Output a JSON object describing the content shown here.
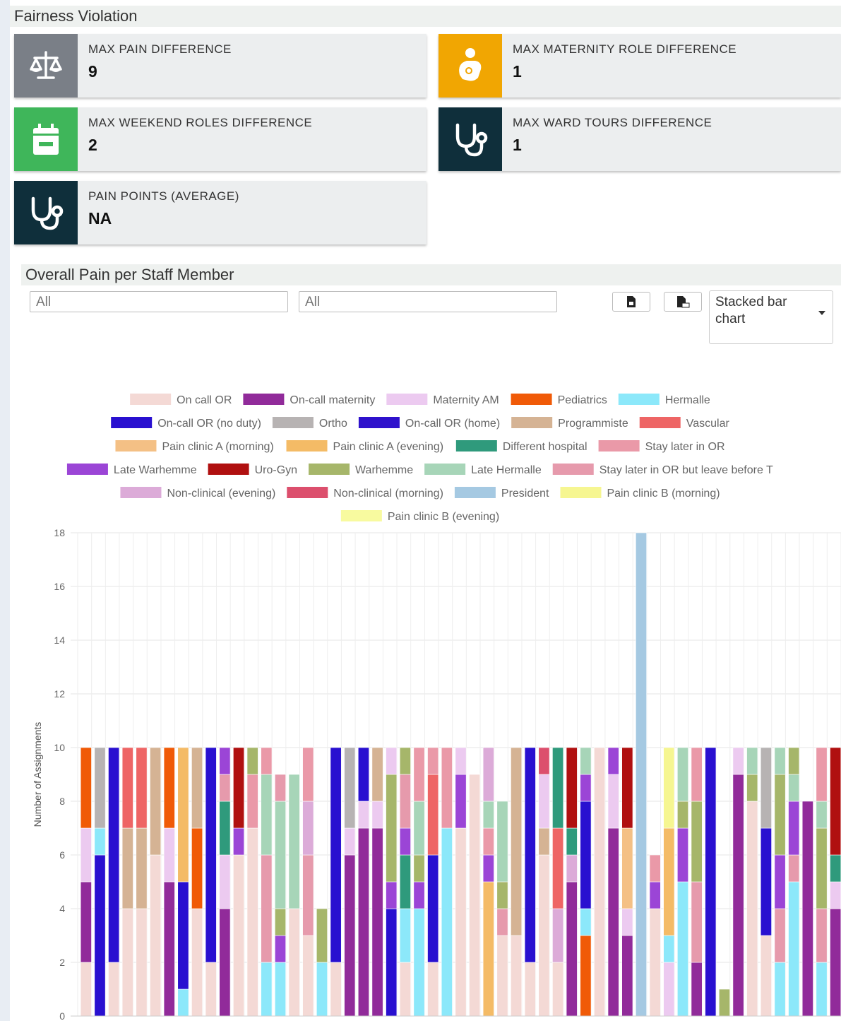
{
  "fairness": {
    "title": "Fairness Violation",
    "cards": [
      {
        "label": "MAX PAIN DIFFERENCE",
        "value": "9",
        "icon": "balance-scale-icon",
        "color": "#7a7f87"
      },
      {
        "label": "MAX MATERNITY ROLE DIFFERENCE",
        "value": "1",
        "icon": "nursing-mother-icon",
        "color": "#f1a602"
      },
      {
        "label": "MAX WEEKEND ROLES DIFFERENCE",
        "value": "2",
        "icon": "calendar-icon",
        "color": "#3fb65a"
      },
      {
        "label": "MAX WARD TOURS DIFFERENCE",
        "value": "1",
        "icon": "stethoscope-icon",
        "color": "#0f2f3b"
      },
      {
        "label": "PAIN POINTS (AVERAGE)",
        "value": "NA",
        "icon": "stethoscope-icon",
        "color": "#0f2f3b"
      }
    ]
  },
  "pain_chart": {
    "title": "Overall Pain per Staff Member",
    "filter1_value": "All",
    "filter2_value": "All",
    "chart_type_select": "Stacked bar chart",
    "export_buttons": [
      "export-png-icon",
      "export-csv-icon"
    ]
  },
  "chart_data": {
    "type": "bar",
    "stacked": true,
    "ylabel": "Number of Assignments",
    "ylim": [
      0,
      18
    ],
    "yticks": [
      "0",
      "2",
      "4",
      "6",
      "8",
      "10",
      "12",
      "14",
      "16",
      "18"
    ],
    "legend_placement": "top",
    "legend": [
      {
        "name": "On call OR",
        "color": "#f4d9d5"
      },
      {
        "name": "On-call maternity",
        "color": "#912b9a"
      },
      {
        "name": "Maternity AM",
        "color": "#eccaf0"
      },
      {
        "name": "Pediatrics",
        "color": "#f05a07"
      },
      {
        "name": "Hermalle",
        "color": "#8ce8fa"
      },
      {
        "name": "On-call OR (no duty)",
        "color": "#2910d0"
      },
      {
        "name": "Ortho",
        "color": "#b7b3b3"
      },
      {
        "name": "On-call OR (home)",
        "color": "#2f12cc"
      },
      {
        "name": "Programmiste",
        "color": "#d5b394"
      },
      {
        "name": "Vascular",
        "color": "#ee6565"
      },
      {
        "name": "Pain clinic A (morning)",
        "color": "#f4c085"
      },
      {
        "name": "Pain clinic A (evening)",
        "color": "#f4bb66"
      },
      {
        "name": "Different hospital",
        "color": "#2f9a7c"
      },
      {
        "name": "Stay later in OR",
        "color": "#ea99a8"
      },
      {
        "name": "Late Warhemme",
        "color": "#9b45d6"
      },
      {
        "name": "Uro-Gyn",
        "color": "#b01010"
      },
      {
        "name": "Warhemme",
        "color": "#a6b66a"
      },
      {
        "name": "Late Hermalle",
        "color": "#a7d5b8"
      },
      {
        "name": "Stay later in OR but leave before T",
        "color": "#e69aac"
      },
      {
        "name": "Non-clinical (evening)",
        "color": "#dcabd8"
      },
      {
        "name": "Non-clinical (morning)",
        "color": "#dc4f6d"
      },
      {
        "name": "President",
        "color": "#a5c9e2"
      },
      {
        "name": "Pain clinic B (morning)",
        "color": "#f6f691"
      },
      {
        "name": "Pain clinic B (evening)",
        "color": "#f8fa9f"
      }
    ],
    "stacks": [
      [
        [
          0,
          2
        ],
        [
          1,
          3
        ],
        [
          2,
          2
        ],
        [
          3,
          3
        ]
      ],
      [
        [
          5,
          6
        ],
        [
          4,
          1
        ],
        [
          6,
          3
        ]
      ],
      [
        [
          0,
          2
        ],
        [
          5,
          8
        ]
      ],
      [
        [
          0,
          4
        ],
        [
          8,
          3
        ],
        [
          9,
          3
        ]
      ],
      [
        [
          0,
          4
        ],
        [
          8,
          3
        ],
        [
          9,
          3
        ]
      ],
      [
        [
          0,
          6
        ],
        [
          8,
          4
        ]
      ],
      [
        [
          1,
          5
        ],
        [
          2,
          2
        ],
        [
          3,
          3
        ]
      ],
      [
        [
          4,
          1
        ],
        [
          5,
          4
        ],
        [
          11,
          5
        ]
      ],
      [
        [
          0,
          4
        ],
        [
          3,
          3
        ],
        [
          8,
          3
        ]
      ],
      [
        [
          0,
          2
        ],
        [
          5,
          8
        ]
      ],
      [
        [
          1,
          4
        ],
        [
          2,
          2
        ],
        [
          12,
          2
        ],
        [
          18,
          1
        ],
        [
          14,
          1
        ]
      ],
      [
        [
          0,
          6
        ],
        [
          14,
          1
        ],
        [
          15,
          3
        ]
      ],
      [
        [
          0,
          7
        ],
        [
          13,
          2
        ],
        [
          16,
          1
        ]
      ],
      [
        [
          4,
          2
        ],
        [
          18,
          4
        ],
        [
          17,
          3
        ],
        [
          13,
          1
        ]
      ],
      [
        [
          4,
          2
        ],
        [
          14,
          1
        ],
        [
          16,
          1
        ],
        [
          17,
          4
        ],
        [
          18,
          1
        ]
      ],
      [
        [
          0,
          4
        ],
        [
          17,
          5
        ]
      ],
      [
        [
          0,
          3
        ],
        [
          18,
          3
        ],
        [
          19,
          2
        ],
        [
          13,
          2
        ]
      ],
      [
        [
          4,
          2
        ],
        [
          16,
          2
        ]
      ],
      [
        [
          0,
          2
        ],
        [
          5,
          8
        ]
      ],
      [
        [
          1,
          6
        ],
        [
          2,
          1
        ],
        [
          6,
          3
        ]
      ],
      [
        [
          1,
          7
        ],
        [
          2,
          1
        ],
        [
          5,
          2
        ]
      ],
      [
        [
          1,
          7
        ],
        [
          2,
          1
        ],
        [
          8,
          2
        ]
      ],
      [
        [
          5,
          4
        ],
        [
          14,
          1
        ],
        [
          16,
          4
        ],
        [
          2,
          1
        ]
      ],
      [
        [
          0,
          2
        ],
        [
          4,
          2
        ],
        [
          12,
          2
        ],
        [
          14,
          1
        ],
        [
          18,
          2
        ],
        [
          16,
          1
        ]
      ],
      [
        [
          4,
          4
        ],
        [
          14,
          1
        ],
        [
          16,
          1
        ],
        [
          17,
          2
        ],
        [
          13,
          2
        ]
      ],
      [
        [
          0,
          2
        ],
        [
          5,
          4
        ],
        [
          9,
          3
        ],
        [
          13,
          1
        ]
      ],
      [
        [
          4,
          7
        ],
        [
          13,
          3
        ]
      ],
      [
        [
          0,
          7
        ],
        [
          14,
          2
        ],
        [
          2,
          1
        ]
      ],
      [
        [
          0,
          9
        ]
      ],
      [
        [
          11,
          5
        ],
        [
          14,
          1
        ],
        [
          13,
          1
        ],
        [
          17,
          1
        ],
        [
          19,
          2
        ]
      ],
      [
        [
          0,
          3
        ],
        [
          18,
          1
        ],
        [
          16,
          1
        ],
        [
          17,
          3
        ]
      ],
      [
        [
          0,
          3
        ],
        [
          6,
          0
        ],
        [
          8,
          7
        ]
      ],
      [
        [
          0,
          2
        ],
        [
          5,
          8
        ]
      ],
      [
        [
          0,
          6
        ],
        [
          8,
          1
        ],
        [
          2,
          2
        ],
        [
          20,
          1
        ]
      ],
      [
        [
          0,
          2
        ],
        [
          19,
          2
        ],
        [
          9,
          3
        ],
        [
          12,
          3
        ]
      ],
      [
        [
          1,
          5
        ],
        [
          19,
          1
        ],
        [
          12,
          1
        ],
        [
          15,
          3
        ]
      ],
      [
        [
          3,
          3
        ],
        [
          4,
          1
        ],
        [
          5,
          4
        ],
        [
          14,
          1
        ],
        [
          17,
          1
        ]
      ],
      [
        [
          0,
          10
        ]
      ],
      [
        [
          1,
          7
        ],
        [
          2,
          2
        ],
        [
          14,
          1
        ]
      ],
      [
        [
          1,
          3
        ],
        [
          2,
          1
        ],
        [
          10,
          3
        ],
        [
          15,
          3
        ]
      ],
      [
        [
          21,
          18
        ]
      ],
      [
        [
          0,
          4
        ],
        [
          14,
          1
        ],
        [
          13,
          1
        ]
      ],
      [
        [
          2,
          2
        ],
        [
          4,
          1
        ],
        [
          11,
          4
        ],
        [
          22,
          3
        ]
      ],
      [
        [
          4,
          5
        ],
        [
          14,
          2
        ],
        [
          16,
          1
        ],
        [
          17,
          2
        ]
      ],
      [
        [
          1,
          2
        ],
        [
          18,
          3
        ],
        [
          16,
          3
        ],
        [
          13,
          2
        ]
      ],
      [
        [
          5,
          10
        ]
      ],
      [
        [
          16,
          1
        ]
      ],
      [
        [
          1,
          9
        ],
        [
          2,
          1
        ]
      ],
      [
        [
          0,
          8
        ],
        [
          16,
          1
        ],
        [
          17,
          1
        ]
      ],
      [
        [
          0,
          3
        ],
        [
          5,
          4
        ],
        [
          6,
          3
        ]
      ],
      [
        [
          4,
          2
        ],
        [
          18,
          2
        ],
        [
          14,
          2
        ],
        [
          16,
          3
        ],
        [
          17,
          1
        ]
      ],
      [
        [
          4,
          5
        ],
        [
          18,
          1
        ],
        [
          14,
          2
        ],
        [
          17,
          1
        ],
        [
          16,
          1
        ]
      ],
      [
        [
          1,
          8
        ]
      ],
      [
        [
          4,
          2
        ],
        [
          18,
          2
        ],
        [
          16,
          3
        ],
        [
          17,
          1
        ],
        [
          13,
          2
        ]
      ],
      [
        [
          1,
          4
        ],
        [
          2,
          1
        ],
        [
          12,
          1
        ],
        [
          15,
          4
        ]
      ]
    ]
  }
}
